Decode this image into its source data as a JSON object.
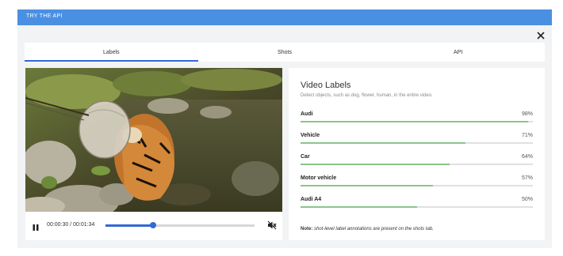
{
  "topbar": {
    "title": "TRY THE API"
  },
  "tabs": [
    {
      "label": "Labels",
      "active": true
    },
    {
      "label": "Shots",
      "active": false
    },
    {
      "label": "API",
      "active": false
    }
  ],
  "player": {
    "time": "00:00:30 / 00:01:34",
    "progress": 0.32,
    "muted": true
  },
  "labels_panel": {
    "title": "Video Labels",
    "subtitle": "Detect objects, such as dog, flower, human, in the entire video.",
    "labels": [
      {
        "name": "Audi",
        "percent": "98%",
        "value": 0.98
      },
      {
        "name": "Vehicle",
        "percent": "71%",
        "value": 0.71
      },
      {
        "name": "Car",
        "percent": "64%",
        "value": 0.64
      },
      {
        "name": "Motor vehicle",
        "percent": "57%",
        "value": 0.57
      },
      {
        "name": "Audi A4",
        "percent": "50%",
        "value": 0.5
      }
    ],
    "note_prefix": "Note:",
    "note_text": "shot-level label annotations are present on the shots tab."
  },
  "colors": {
    "topbar": "#4a90e2",
    "accent": "#3367d6",
    "label_bar": "#8bc48a"
  }
}
